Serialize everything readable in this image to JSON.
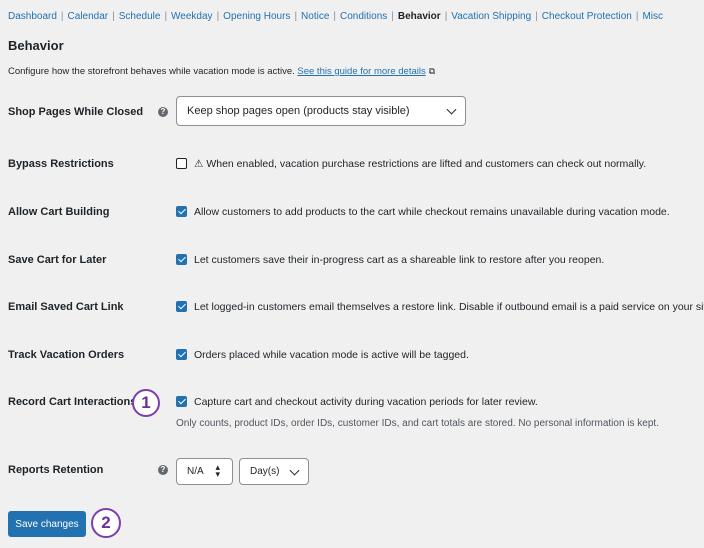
{
  "nav": {
    "items": [
      "Dashboard",
      "Calendar",
      "Schedule",
      "Weekday",
      "Opening Hours",
      "Notice",
      "Conditions",
      "Behavior",
      "Vacation Shipping",
      "Checkout Protection",
      "Misc"
    ],
    "separator": "|",
    "current": "Behavior"
  },
  "page": {
    "title": "Behavior",
    "description": "Configure how the storefront behaves while vacation mode is active.",
    "guide_link": "See this guide for more details",
    "guide_icon": "external-link-icon"
  },
  "settings": {
    "shop_pages": {
      "label": "Shop Pages While Closed",
      "help": "?",
      "value": "Keep shop pages open (products stay visible)"
    },
    "bypass": {
      "label": "Bypass Restrictions",
      "checked": false,
      "text": "⚠ When enabled, vacation purchase restrictions are lifted and customers can check out normally."
    },
    "cart_building": {
      "label": "Allow Cart Building",
      "checked": true,
      "text": "Allow customers to add products to the cart while checkout remains unavailable during vacation mode."
    },
    "save_cart": {
      "label": "Save Cart for Later",
      "checked": true,
      "text": "Let customers save their in-progress cart as a shareable link to restore after you reopen."
    },
    "email_cart": {
      "label": "Email Saved Cart Link",
      "checked": true,
      "text": "Let logged-in customers email themselves a restore link. Disable if outbound email is a paid service on your sit"
    },
    "track_orders": {
      "label": "Track Vacation Orders",
      "checked": true,
      "text": "Orders placed while vacation mode is active will be tagged."
    },
    "record_cart": {
      "label": "Record Cart Interactions",
      "checked": true,
      "text": "Capture cart and checkout activity during vacation periods for later review.",
      "note": "Only counts, product IDs, order IDs, customer IDs, and cart totals are stored. No personal information is kept."
    },
    "retention": {
      "label": "Reports Retention",
      "help": "?",
      "number_value": "N/A",
      "unit": "Day(s)"
    }
  },
  "actions": {
    "save": "Save changes"
  },
  "markers": {
    "one": "1",
    "two": "2"
  },
  "colors": {
    "accent": "#2271b1",
    "marker": "#7b3fb0",
    "background": "#f0f0f1"
  }
}
